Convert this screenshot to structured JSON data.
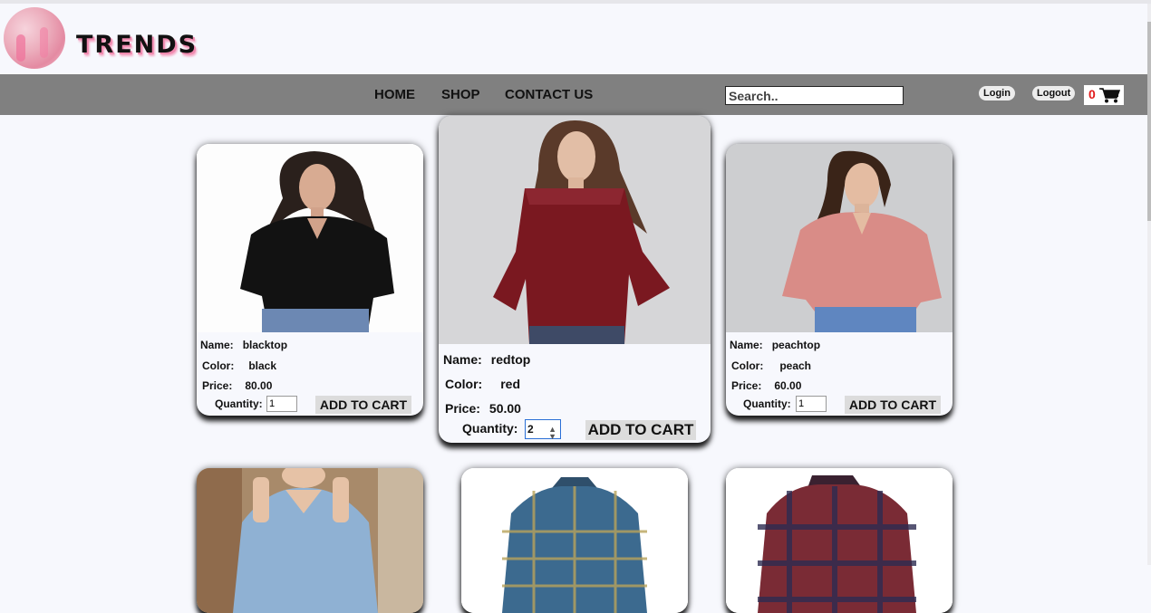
{
  "brand": {
    "name": "TRENDS",
    "logo_icon": "logo-circle"
  },
  "nav": {
    "links": [
      {
        "label": "HOME"
      },
      {
        "label": "SHOP"
      },
      {
        "label": "CONTACT US"
      }
    ],
    "search_placeholder": "Search..",
    "login": "Login",
    "logout": "Logout",
    "cart_count": "0",
    "cart_icon": "cart-icon"
  },
  "labels": {
    "name": "Name:",
    "color": "Color:",
    "price": "Price:",
    "quantity": "Quantity:",
    "add_to_cart": "ADD TO CART"
  },
  "products": [
    {
      "name": "blacktop",
      "color": "black",
      "price": "80.00",
      "quantity": "1",
      "image": "black-top-photo"
    },
    {
      "name": "redtop",
      "color": "red",
      "price": "50.00",
      "quantity": "2",
      "image": "red-top-photo"
    },
    {
      "name": "peachtop",
      "color": "peach",
      "price": "60.00",
      "quantity": "1",
      "image": "peach-top-photo"
    },
    {
      "image": "denim-shirt-photo"
    },
    {
      "image": "blue-plaid-shirt-photo"
    },
    {
      "image": "red-plaid-shirt-photo"
    }
  ],
  "colors": {
    "navbar": "#808080",
    "page_background": "#f7f8fd",
    "cart_count": "#e21b1b",
    "button": "#dcdcdc"
  }
}
